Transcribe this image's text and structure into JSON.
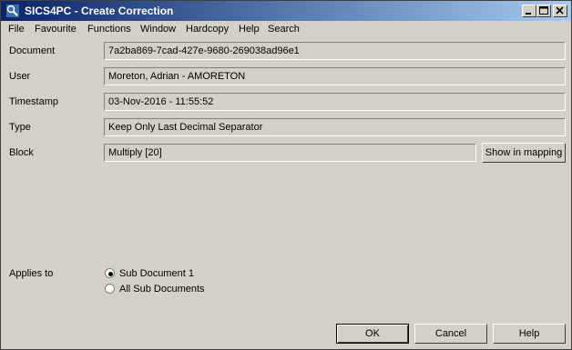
{
  "window": {
    "title": "SICS4PC - Create Correction"
  },
  "menu": [
    "File",
    "Favourite",
    "Functions",
    "Window",
    "Hardcopy",
    "Help",
    "Search"
  ],
  "fields": {
    "document": {
      "label": "Document",
      "value": "7a2ba869-7cad-427e-9680-269038ad96e1"
    },
    "user": {
      "label": "User",
      "value": "Moreton, Adrian - AMORETON"
    },
    "timestamp": {
      "label": "Timestamp",
      "value": "03-Nov-2016 - 11:55:52"
    },
    "type": {
      "label": "Type",
      "value": "Keep Only Last Decimal Separator"
    },
    "block": {
      "label": "Block",
      "value": "Multiply [20]"
    }
  },
  "show_in_mapping_label": "Show in mapping",
  "applies_to": {
    "label": "Applies to",
    "options": [
      "Sub Document 1",
      "All Sub Documents"
    ],
    "selected": "Sub Document 1"
  },
  "buttons": {
    "ok": "OK",
    "cancel": "Cancel",
    "help": "Help"
  }
}
